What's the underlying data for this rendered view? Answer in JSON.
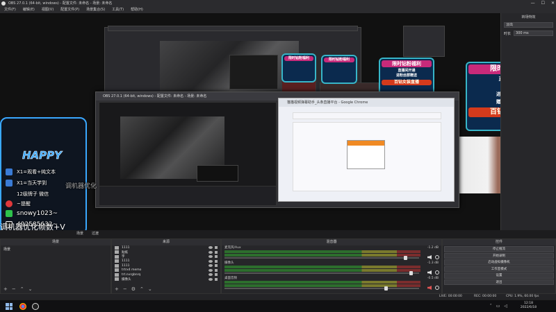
{
  "window": {
    "title": "OBS 27.0.1 (64-bit, windows) - 配置文件: 未命名 - 场景: 未命名",
    "min": "—",
    "max": "☐",
    "close": "✕"
  },
  "menu": [
    "文件(F)",
    "编辑(E)",
    "视图(V)",
    "配置文件(P)",
    "场景集合(S)",
    "工具(T)",
    "帮助(H)"
  ],
  "nested_obs": {
    "title": "OBS 27.0.1 (64-bit, windows) - 配置文件: 未命名 - 场景: 未命名"
  },
  "chrome": {
    "title": "猫猫视频弹幕助手_头条直播平台 - Google Chrome"
  },
  "promo_main": {
    "head": "限时钻粉福利",
    "lines": [
      "直播间开通",
      "钻粉",
      "进粉丝群赠送",
      "赠送粉丝福利"
    ],
    "big": "百钻女装直播"
  },
  "overlay": {
    "title": "HAPPY",
    "lines": [
      "X1=观看+纯文本",
      "X1=当天学到",
      "12级牌子 微信",
      "~提醒",
      "snowy1023~",
      "492585632~"
    ],
    "optimize_text": "调机器优化帧数+V",
    "side_text": "调机器优化"
  },
  "right_panel": {
    "title": "转场特效",
    "select_label": "淡出",
    "duration_label": "时长",
    "duration_value": "300 ms"
  },
  "controls": {
    "studio": "场景",
    "transition": "过渡"
  },
  "docks": {
    "scenes": {
      "title": "场景",
      "items": [
        "场景"
      ]
    },
    "sources": {
      "title": "来源",
      "items": [
        "1111",
        "贴纸",
        "字",
        "1111",
        "1111",
        "trtrx4 memo",
        "trt.nvrgbnrq",
        "摄像头"
      ]
    },
    "mixer": {
      "title": "混音器",
      "channels": [
        {
          "name": "麦克风/Aux",
          "db": "-1.2 dB",
          "muted": false,
          "level": 0.92
        },
        {
          "name": "摄像头",
          "db": "-1.3 dB",
          "muted": false,
          "level": 0.95
        },
        {
          "name": "桌面音频",
          "db": "-0.5 dB",
          "muted": true,
          "level": 0.82
        }
      ]
    },
    "controls": {
      "title": "控件",
      "buttons": [
        "停止推流",
        "开始录制",
        "启动虚拟摄像机",
        "工作室模式",
        "设置",
        "退出"
      ]
    }
  },
  "status": {
    "live": "LIVE: 00:00:00",
    "rec": "REC: 00:00:00",
    "cpu": "CPU: 1.9%, 60.00 fps"
  },
  "clock": {
    "time": "12:18",
    "date": "2022/6/18"
  }
}
